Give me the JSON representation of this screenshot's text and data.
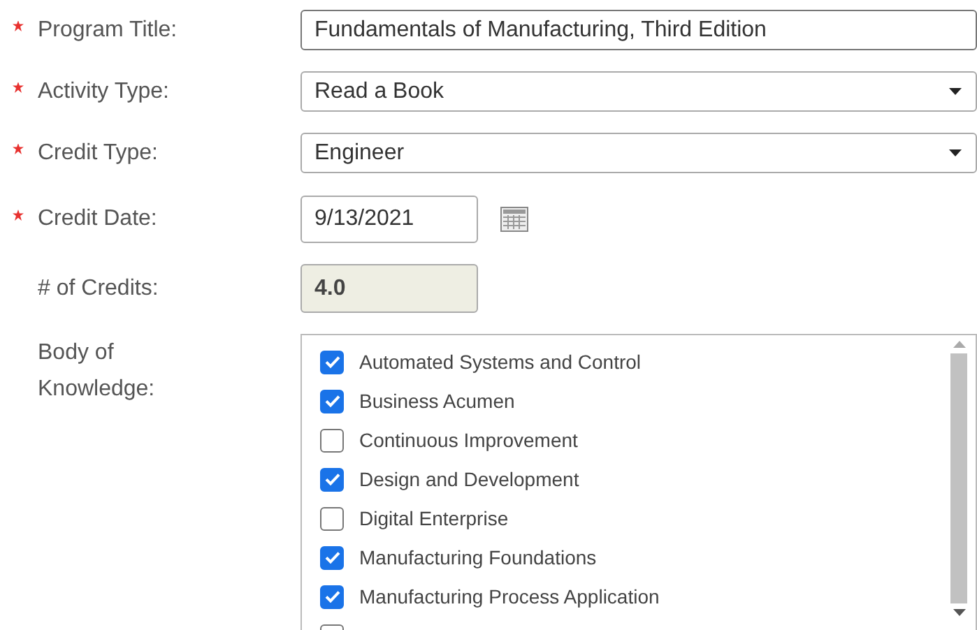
{
  "fields": [
    {
      "label": "Program Title:",
      "required": true,
      "kind": "text",
      "value": "Fundamentals of Manufacturing, Third Edition"
    },
    {
      "label": "Activity Type:",
      "required": true,
      "kind": "select",
      "value": "Read a Book"
    },
    {
      "label": "Credit Type:",
      "required": true,
      "kind": "select",
      "value": "Engineer"
    },
    {
      "label": "Credit Date:",
      "required": true,
      "kind": "date",
      "value": "9/13/2021"
    },
    {
      "label": "# of Credits:",
      "required": false,
      "kind": "readonly",
      "value": "4.0"
    }
  ],
  "body_of_knowledge": {
    "label": "Body of Knowledge:",
    "items": [
      {
        "label": "Automated Systems and Control",
        "checked": true
      },
      {
        "label": "Business Acumen",
        "checked": true
      },
      {
        "label": "Continuous Improvement",
        "checked": false
      },
      {
        "label": "Design and Development",
        "checked": true
      },
      {
        "label": "Digital Enterprise",
        "checked": false
      },
      {
        "label": "Manufacturing Foundations",
        "checked": true
      },
      {
        "label": "Manufacturing Process Application",
        "checked": true
      }
    ]
  }
}
